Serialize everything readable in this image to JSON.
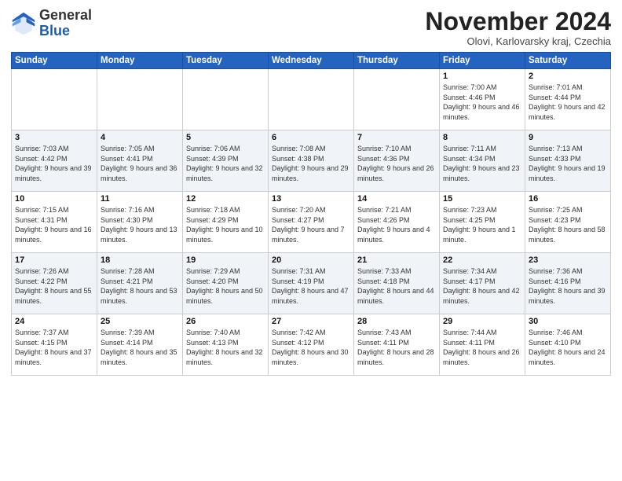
{
  "logo": {
    "general": "General",
    "blue": "Blue"
  },
  "title": "November 2024",
  "subtitle": "Olovi, Karlovarsky kraj, Czechia",
  "days_of_week": [
    "Sunday",
    "Monday",
    "Tuesday",
    "Wednesday",
    "Thursday",
    "Friday",
    "Saturday"
  ],
  "weeks": [
    [
      {
        "day": "",
        "info": ""
      },
      {
        "day": "",
        "info": ""
      },
      {
        "day": "",
        "info": ""
      },
      {
        "day": "",
        "info": ""
      },
      {
        "day": "",
        "info": ""
      },
      {
        "day": "1",
        "info": "Sunrise: 7:00 AM\nSunset: 4:46 PM\nDaylight: 9 hours and 46 minutes."
      },
      {
        "day": "2",
        "info": "Sunrise: 7:01 AM\nSunset: 4:44 PM\nDaylight: 9 hours and 42 minutes."
      }
    ],
    [
      {
        "day": "3",
        "info": "Sunrise: 7:03 AM\nSunset: 4:42 PM\nDaylight: 9 hours and 39 minutes."
      },
      {
        "day": "4",
        "info": "Sunrise: 7:05 AM\nSunset: 4:41 PM\nDaylight: 9 hours and 36 minutes."
      },
      {
        "day": "5",
        "info": "Sunrise: 7:06 AM\nSunset: 4:39 PM\nDaylight: 9 hours and 32 minutes."
      },
      {
        "day": "6",
        "info": "Sunrise: 7:08 AM\nSunset: 4:38 PM\nDaylight: 9 hours and 29 minutes."
      },
      {
        "day": "7",
        "info": "Sunrise: 7:10 AM\nSunset: 4:36 PM\nDaylight: 9 hours and 26 minutes."
      },
      {
        "day": "8",
        "info": "Sunrise: 7:11 AM\nSunset: 4:34 PM\nDaylight: 9 hours and 23 minutes."
      },
      {
        "day": "9",
        "info": "Sunrise: 7:13 AM\nSunset: 4:33 PM\nDaylight: 9 hours and 19 minutes."
      }
    ],
    [
      {
        "day": "10",
        "info": "Sunrise: 7:15 AM\nSunset: 4:31 PM\nDaylight: 9 hours and 16 minutes."
      },
      {
        "day": "11",
        "info": "Sunrise: 7:16 AM\nSunset: 4:30 PM\nDaylight: 9 hours and 13 minutes."
      },
      {
        "day": "12",
        "info": "Sunrise: 7:18 AM\nSunset: 4:29 PM\nDaylight: 9 hours and 10 minutes."
      },
      {
        "day": "13",
        "info": "Sunrise: 7:20 AM\nSunset: 4:27 PM\nDaylight: 9 hours and 7 minutes."
      },
      {
        "day": "14",
        "info": "Sunrise: 7:21 AM\nSunset: 4:26 PM\nDaylight: 9 hours and 4 minutes."
      },
      {
        "day": "15",
        "info": "Sunrise: 7:23 AM\nSunset: 4:25 PM\nDaylight: 9 hours and 1 minute."
      },
      {
        "day": "16",
        "info": "Sunrise: 7:25 AM\nSunset: 4:23 PM\nDaylight: 8 hours and 58 minutes."
      }
    ],
    [
      {
        "day": "17",
        "info": "Sunrise: 7:26 AM\nSunset: 4:22 PM\nDaylight: 8 hours and 55 minutes."
      },
      {
        "day": "18",
        "info": "Sunrise: 7:28 AM\nSunset: 4:21 PM\nDaylight: 8 hours and 53 minutes."
      },
      {
        "day": "19",
        "info": "Sunrise: 7:29 AM\nSunset: 4:20 PM\nDaylight: 8 hours and 50 minutes."
      },
      {
        "day": "20",
        "info": "Sunrise: 7:31 AM\nSunset: 4:19 PM\nDaylight: 8 hours and 47 minutes."
      },
      {
        "day": "21",
        "info": "Sunrise: 7:33 AM\nSunset: 4:18 PM\nDaylight: 8 hours and 44 minutes."
      },
      {
        "day": "22",
        "info": "Sunrise: 7:34 AM\nSunset: 4:17 PM\nDaylight: 8 hours and 42 minutes."
      },
      {
        "day": "23",
        "info": "Sunrise: 7:36 AM\nSunset: 4:16 PM\nDaylight: 8 hours and 39 minutes."
      }
    ],
    [
      {
        "day": "24",
        "info": "Sunrise: 7:37 AM\nSunset: 4:15 PM\nDaylight: 8 hours and 37 minutes."
      },
      {
        "day": "25",
        "info": "Sunrise: 7:39 AM\nSunset: 4:14 PM\nDaylight: 8 hours and 35 minutes."
      },
      {
        "day": "26",
        "info": "Sunrise: 7:40 AM\nSunset: 4:13 PM\nDaylight: 8 hours and 32 minutes."
      },
      {
        "day": "27",
        "info": "Sunrise: 7:42 AM\nSunset: 4:12 PM\nDaylight: 8 hours and 30 minutes."
      },
      {
        "day": "28",
        "info": "Sunrise: 7:43 AM\nSunset: 4:11 PM\nDaylight: 8 hours and 28 minutes."
      },
      {
        "day": "29",
        "info": "Sunrise: 7:44 AM\nSunset: 4:11 PM\nDaylight: 8 hours and 26 minutes."
      },
      {
        "day": "30",
        "info": "Sunrise: 7:46 AM\nSunset: 4:10 PM\nDaylight: 8 hours and 24 minutes."
      }
    ]
  ]
}
